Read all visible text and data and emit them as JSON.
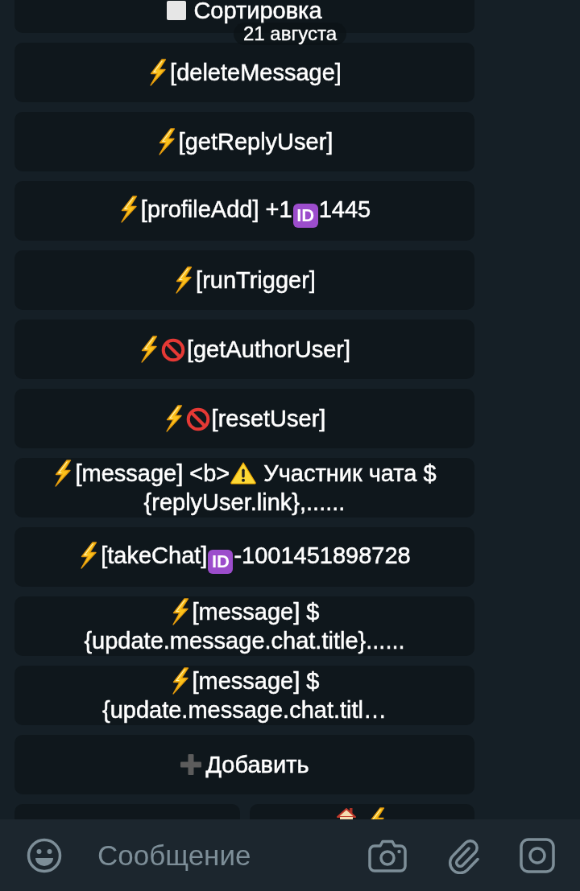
{
  "chat": {
    "date_badge": "21 августа",
    "keyboard_rows": [
      [
        {
          "lines": [
            [
              {
                "kind": "square"
              },
              {
                "kind": "text",
                "text": "Сортировка"
              }
            ]
          ]
        }
      ],
      [
        {
          "lines": [
            [
              {
                "kind": "bolt"
              },
              {
                "kind": "text",
                "text": "[deleteMessage]"
              }
            ]
          ]
        }
      ],
      [
        {
          "lines": [
            [
              {
                "kind": "bolt"
              },
              {
                "kind": "text",
                "text": "[getReplyUser]"
              }
            ]
          ]
        }
      ],
      [
        {
          "lines": [
            [
              {
                "kind": "bolt"
              },
              {
                "kind": "text",
                "text": "[profileAdd] +1"
              },
              {
                "kind": "id",
                "text": "ID"
              },
              {
                "kind": "text",
                "text": "1445"
              }
            ]
          ]
        }
      ],
      [
        {
          "lines": [
            [
              {
                "kind": "bolt"
              },
              {
                "kind": "text",
                "text": "[runTrigger]"
              }
            ]
          ]
        }
      ],
      [
        {
          "lines": [
            [
              {
                "kind": "bolt"
              },
              {
                "kind": "no_entry"
              },
              {
                "kind": "text",
                "text": "[getAuthorUser]"
              }
            ]
          ]
        }
      ],
      [
        {
          "lines": [
            [
              {
                "kind": "bolt"
              },
              {
                "kind": "no_entry"
              },
              {
                "kind": "text",
                "text": "[resetUser]"
              }
            ]
          ]
        }
      ],
      [
        {
          "lines": [
            [
              {
                "kind": "bolt"
              },
              {
                "kind": "text",
                "text": "[message] <b>"
              },
              {
                "kind": "warning"
              },
              {
                "kind": "text",
                "text": "Участник чата $"
              }
            ],
            [
              {
                "kind": "text",
                "text": "{replyUser.link},......"
              }
            ]
          ]
        }
      ],
      [
        {
          "lines": [
            [
              {
                "kind": "bolt"
              },
              {
                "kind": "text",
                "text": "[takeChat]"
              },
              {
                "kind": "id",
                "text": "ID"
              },
              {
                "kind": "text",
                "text": "-1001451898728"
              }
            ]
          ]
        }
      ],
      [
        {
          "lines": [
            [
              {
                "kind": "bolt"
              },
              {
                "kind": "text",
                "text": "[message] $"
              }
            ],
            [
              {
                "kind": "text",
                "text": "{update.message.chat.title}......"
              }
            ]
          ]
        }
      ],
      [
        {
          "lines": [
            [
              {
                "kind": "bolt"
              },
              {
                "kind": "text",
                "text": "[message] $"
              }
            ],
            [
              {
                "kind": "text",
                "text": "{update.message.chat.titl…"
              }
            ]
          ]
        }
      ],
      [
        {
          "lines": [
            [
              {
                "kind": "plus"
              },
              {
                "kind": "text",
                "text": "Добавить"
              }
            ]
          ]
        }
      ],
      [
        {},
        {
          "lines": [
            [
              {
                "kind": "house"
              },
              {
                "kind": "bolt"
              }
            ]
          ]
        }
      ]
    ]
  },
  "composer": {
    "placeholder": "Сообщение"
  }
}
